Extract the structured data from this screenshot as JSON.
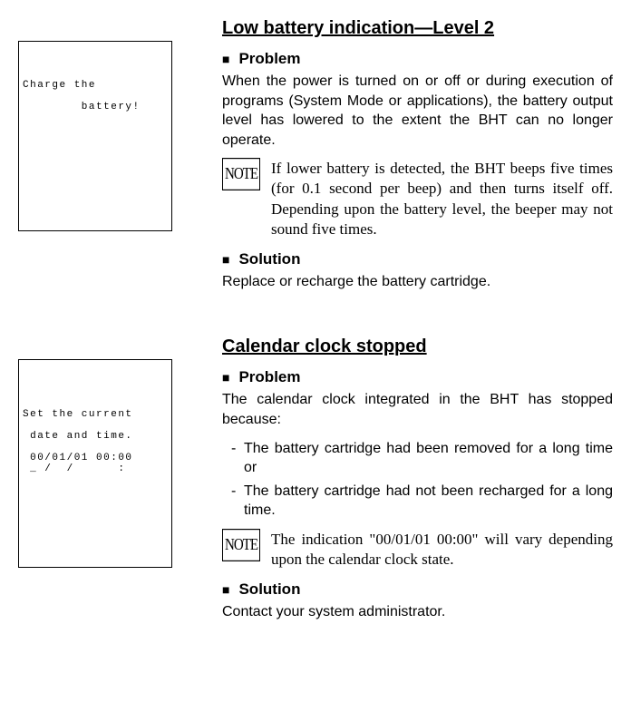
{
  "section1": {
    "title": "Low battery indication—Level 2",
    "sidebox_lines": "\n\n\nCharge the\n\n        battery!",
    "problem_label": "Problem",
    "problem_text": "When the power is turned on or off or during execution of programs (System Mode or applications), the battery output level has lowered to the extent the BHT can no longer operate.",
    "note_label": "NOTE",
    "note_text": "If lower battery is detected, the BHT beeps five times (for 0.1 second per beep) and then turns itself off.  Depending upon the battery level, the beeper may not sound five times.",
    "solution_label": "Solution",
    "solution_text": "Replace or recharge the battery cartridge."
  },
  "section2": {
    "title": "Calendar clock stopped",
    "sidebox_lines": "\n\n\n\nSet the current\n\n date and time.\n\n 00/01/01 00:00\n _ /  /      :",
    "problem_label": "Problem",
    "problem_text": "The calendar clock integrated in the BHT has stopped because:",
    "causes": [
      "The battery cartridge had been removed for a long time or",
      "The battery cartridge had not been recharged for a long time."
    ],
    "note_label": "NOTE",
    "note_text": "The indication \"00/01/01 00:00\" will vary depending upon the calendar clock state.",
    "solution_label": "Solution",
    "solution_text": "Contact your system administrator."
  },
  "bullet": "■",
  "dash": "-"
}
